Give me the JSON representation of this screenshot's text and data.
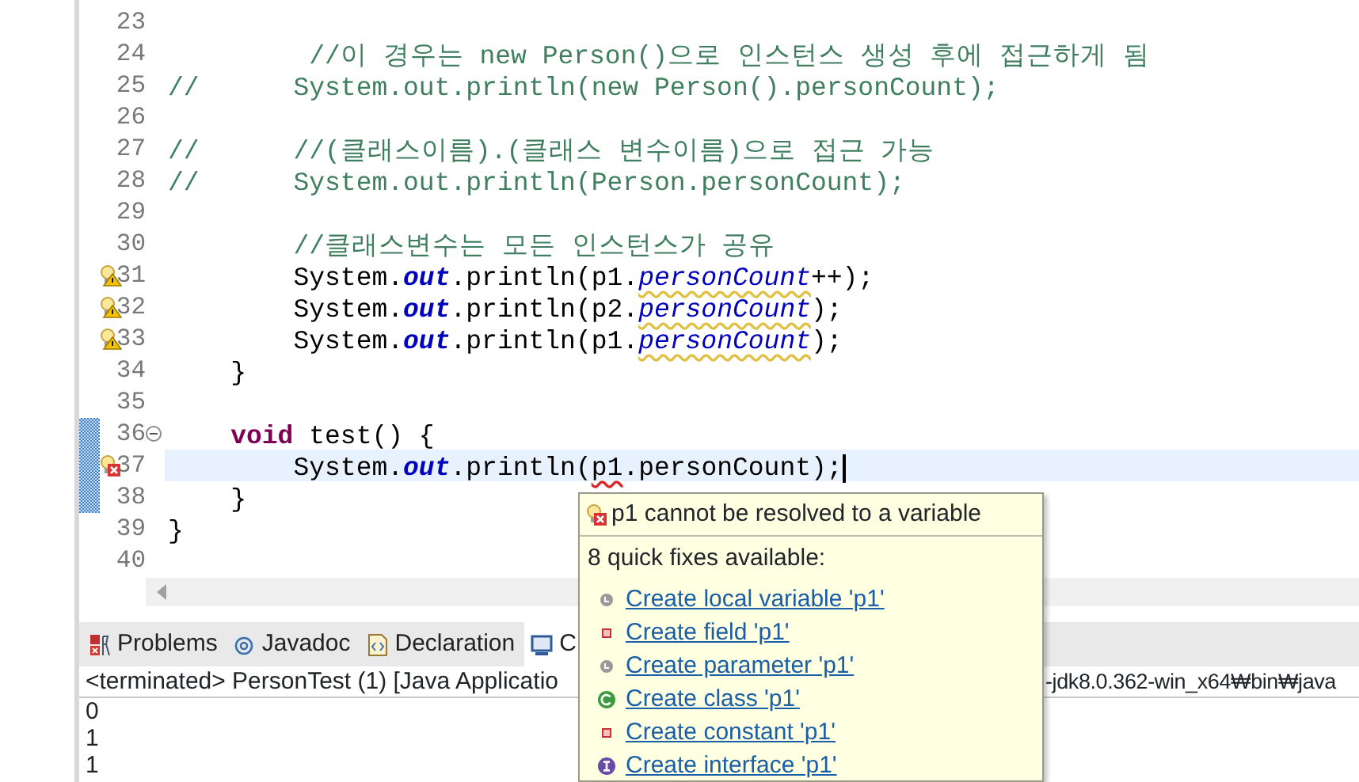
{
  "editor": {
    "lines": [
      {
        "number": "23"
      },
      {
        "number": "24",
        "segments": [
          {
            "kind": "comment",
            "text": "         //이 경우는 new Person()으로 인스턴스 생성 후에 접근하게 됨"
          }
        ]
      },
      {
        "number": "25",
        "segments": [
          {
            "kind": "comment",
            "text": "//      System.out.println(new Person().personCount);"
          }
        ]
      },
      {
        "number": "26"
      },
      {
        "number": "27",
        "segments": [
          {
            "kind": "comment",
            "text": "//      //(클래스이름).(클래스 변수이름)으로 접근 가능"
          }
        ]
      },
      {
        "number": "28",
        "segments": [
          {
            "kind": "comment",
            "text": "//      System.out.println(Person.personCount);"
          }
        ]
      },
      {
        "number": "29"
      },
      {
        "number": "30",
        "segments": [
          {
            "kind": "comment",
            "text": "        //클래스변수는 모든 인스턴스가 공유"
          }
        ]
      },
      {
        "number": "31",
        "warning": true,
        "segments": [
          {
            "kind": "plain",
            "text": "        System."
          },
          {
            "kind": "static",
            "text": "out"
          },
          {
            "kind": "plain",
            "text": ".println(p1."
          },
          {
            "kind": "field_warning",
            "text": "personCount"
          },
          {
            "kind": "plain",
            "text": "++);"
          }
        ]
      },
      {
        "number": "32",
        "warning": true,
        "segments": [
          {
            "kind": "plain",
            "text": "        System."
          },
          {
            "kind": "static",
            "text": "out"
          },
          {
            "kind": "plain",
            "text": ".println(p2."
          },
          {
            "kind": "field_warning",
            "text": "personCount"
          },
          {
            "kind": "plain",
            "text": ");"
          }
        ]
      },
      {
        "number": "33",
        "warning": true,
        "segments": [
          {
            "kind": "plain",
            "text": "        System."
          },
          {
            "kind": "static",
            "text": "out"
          },
          {
            "kind": "plain",
            "text": ".println(p1."
          },
          {
            "kind": "field_warning",
            "text": "personCount"
          },
          {
            "kind": "plain",
            "text": ");"
          }
        ]
      },
      {
        "number": "34",
        "segments": [
          {
            "kind": "plain",
            "text": "    }"
          }
        ]
      },
      {
        "number": "35"
      },
      {
        "number": "36",
        "ruler_mark": true,
        "foldable": true,
        "segments": [
          {
            "kind": "keyword",
            "text": "    void"
          },
          {
            "kind": "plain",
            "text": " test() {"
          }
        ]
      },
      {
        "number": "37",
        "ruler_mark": true,
        "error": true,
        "current": true,
        "cursor": true,
        "segments": [
          {
            "kind": "plain",
            "text": "        System."
          },
          {
            "kind": "static",
            "text": "out"
          },
          {
            "kind": "plain",
            "text": ".println("
          },
          {
            "kind": "error",
            "text": "p1"
          },
          {
            "kind": "plain",
            "text": ".personCount);"
          }
        ]
      },
      {
        "number": "38",
        "ruler_mark": true,
        "segments": [
          {
            "kind": "plain",
            "text": "    }"
          }
        ]
      },
      {
        "number": "39",
        "segments": [
          {
            "kind": "plain",
            "text": "}"
          }
        ]
      },
      {
        "number": "40"
      }
    ]
  },
  "bottom_panel": {
    "tabs": [
      {
        "label": "Problems",
        "kind": "problems",
        "selected": false
      },
      {
        "label": "Javadoc",
        "kind": "javadoc",
        "selected": false
      },
      {
        "label": "Declaration",
        "kind": "declaration",
        "selected": false
      },
      {
        "label": "C",
        "kind": "console",
        "selected": true
      }
    ],
    "console_header_left": "<terminated> PersonTest (1) [Java Applicatio",
    "console_header_right": "-jdk8.0.362-win_x64₩bin₩java",
    "output": [
      "0",
      "1",
      "1"
    ]
  },
  "quick_fix_popup": {
    "title": "p1 cannot be resolved to a variable",
    "subtitle": "8 quick fixes available:",
    "fixes": [
      {
        "label": "Create local variable 'p1'",
        "kind": "local"
      },
      {
        "label": "Create field 'p1'",
        "kind": "field"
      },
      {
        "label": "Create parameter 'p1'",
        "kind": "local"
      },
      {
        "label": "Create class 'p1'",
        "kind": "class"
      },
      {
        "label": "Create constant 'p1'",
        "kind": "field"
      },
      {
        "label": "Create interface 'p1'",
        "kind": "interface"
      }
    ]
  }
}
